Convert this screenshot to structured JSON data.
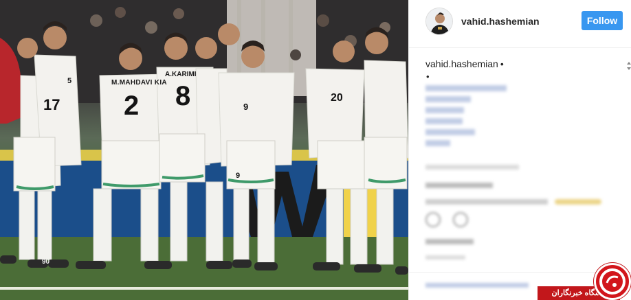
{
  "post": {
    "username": "vahid.hashemian",
    "follow_label": "Follow",
    "caption_username": "vahid.hashemian",
    "caption_separator": "•",
    "caption_dot": "•"
  },
  "photo": {
    "jersey_names": [
      "M.MAHDAVI KIA",
      "A.KARIMI"
    ],
    "jersey_numbers": [
      "2",
      "8",
      "9",
      "20",
      "17",
      "5",
      "9"
    ],
    "sock_number": "90"
  },
  "watermark": {
    "label": "باشگاه خبرنگاران"
  },
  "colors": {
    "follow_bg": "#3897f0",
    "hashtag": "#3d5fa8",
    "watermark_red": "#c2171b"
  },
  "icons": [
    "avatar-icon",
    "like-icon",
    "comment-icon"
  ]
}
